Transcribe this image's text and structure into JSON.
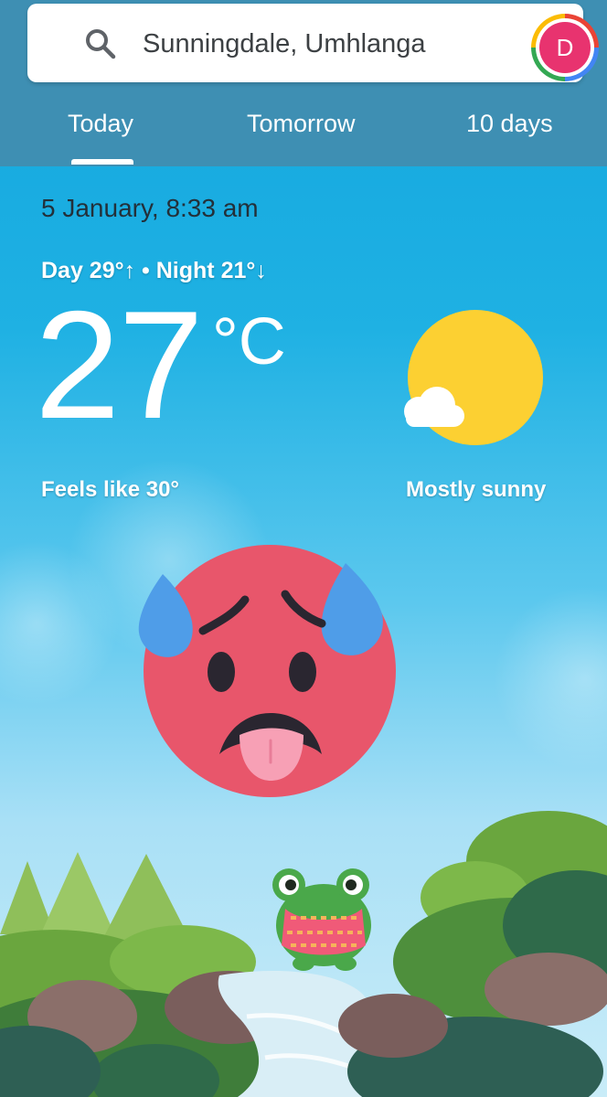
{
  "search": {
    "location": "Sunningdale, Umhlanga",
    "avatar_letter": "D"
  },
  "tabs": [
    {
      "label": "Today",
      "selected": true
    },
    {
      "label": "Tomorrow",
      "selected": false
    },
    {
      "label": "10 days",
      "selected": false
    }
  ],
  "weather": {
    "datetime": "5 January, 8:33 am",
    "day_night": "Day 29°↑ • Night 21°↓",
    "temperature": "27",
    "unit": "°C",
    "feels_like": "Feels like 30°",
    "condition": "Mostly sunny",
    "condition_icon": "sun-with-cloud-icon"
  },
  "illustration": {
    "character": "hot-face-emoji",
    "scene": "frog-by-stream-illustration"
  },
  "colors": {
    "header": "#3e8fb3",
    "sky_top": "#12a6de",
    "avatar": "#e8336f",
    "sun": "#fdd835",
    "emoji_face": "#e8566b",
    "sweat_drop": "#4f9de8"
  }
}
